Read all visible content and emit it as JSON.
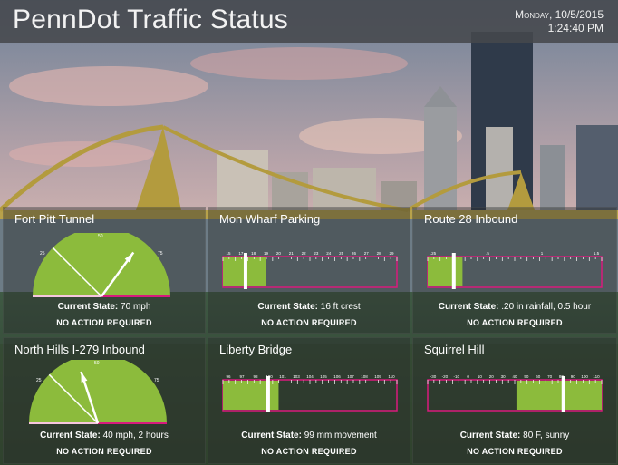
{
  "header": {
    "title": "PennDot Traffic Status",
    "day": "Monday, 10/5/2015",
    "time": "1:24:40 PM"
  },
  "colors": {
    "good": "#8cbb3c",
    "outline": "#d81b7d",
    "needle": "#ffffff"
  },
  "panels": [
    {
      "title": "Fort Pitt Tunnel",
      "kind": "gauge",
      "ticks": [
        "25",
        "50",
        "75"
      ],
      "value_fraction": 0.7,
      "state_label": "Current State:",
      "state_value": "70 mph",
      "action": "NO ACTION REQUIRED"
    },
    {
      "title": "Mon Wharf Parking",
      "kind": "bar",
      "ticks": [
        "15",
        "17",
        "18",
        "19",
        "20",
        "21",
        "22",
        "23",
        "24",
        "25",
        "26",
        "27",
        "28",
        "29"
      ],
      "fill_fraction": 0.25,
      "marker_fraction": 0.13,
      "state_label": "Current State:",
      "state_value": "16 ft crest",
      "action": "NO ACTION REQUIRED"
    },
    {
      "title": "Route 28 Inbound",
      "kind": "bar",
      "ticks": [
        ".25",
        ".5",
        "1",
        "1.5"
      ],
      "fill_fraction": 0.2,
      "marker_fraction": 0.15,
      "state_label": "Current State:",
      "state_value": ".20 in rainfall, 0.5 hour",
      "action": "NO ACTION REQUIRED"
    },
    {
      "title": "North Hills I-279 Inbound",
      "kind": "gauge",
      "ticks": [
        "25",
        "50",
        "75"
      ],
      "value_fraction": 0.4,
      "state_label": "Current State:",
      "state_value": "40 mph, 2 hours",
      "action": "NO ACTION REQUIRED"
    },
    {
      "title": "Liberty Bridge",
      "kind": "bar",
      "ticks": [
        "96",
        "97",
        "98",
        "100",
        "101",
        "103",
        "104",
        "105",
        "106",
        "107",
        "108",
        "109",
        "110"
      ],
      "fill_fraction": 0.32,
      "marker_fraction": 0.26,
      "state_label": "Current State:",
      "state_value": "99 mm movement",
      "action": "NO ACTION REQUIRED"
    },
    {
      "title": "Squirrel Hill",
      "kind": "bar",
      "ticks": [
        "-30",
        "-20",
        "-10",
        "0",
        "10",
        "20",
        "30",
        "40",
        "50",
        "60",
        "70",
        "80",
        "90",
        "100",
        "110"
      ],
      "fill_fraction": 0.49,
      "marker_fraction": 0.78,
      "fill_side": "right",
      "state_label": "Current State:",
      "state_value": "80 F, sunny",
      "action": "NO ACTION REQUIRED"
    }
  ]
}
